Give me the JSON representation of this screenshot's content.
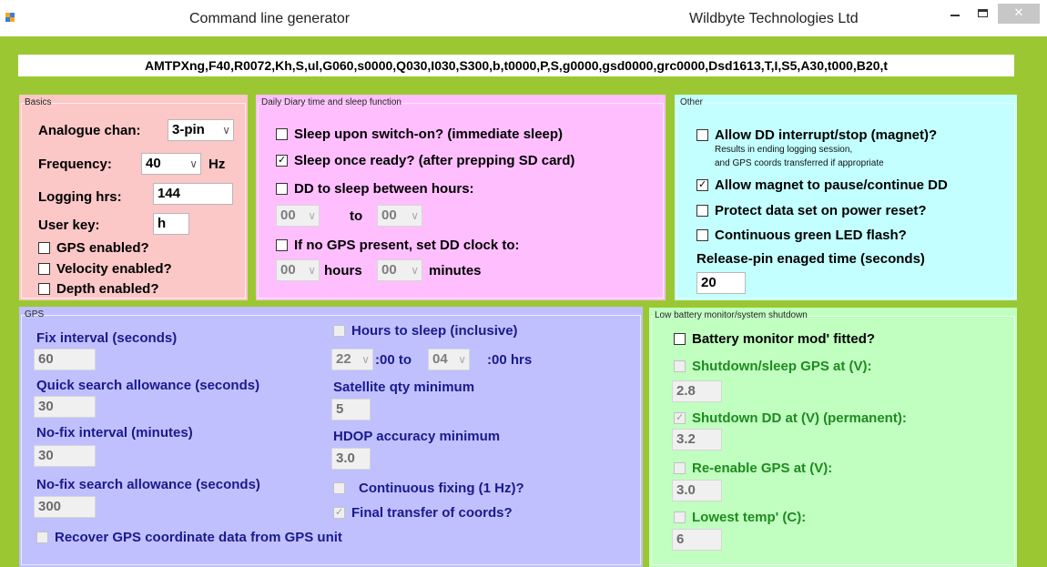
{
  "titlebar": {
    "title": "Command line generator",
    "company": "Wildbyte Technologies Ltd",
    "minimize_icon": "minimize-icon",
    "maximize_icon": "maximize-icon",
    "close_icon": "close-icon",
    "close_label": "✕"
  },
  "command_line": "AMTPXng,F40,R0072,Kh,S,ul,G060,s0000,Q030,I030,S300,b,t0000,P,S,g0000,gsd0000,grc0000,Dsd1613,T,I,S5,A30,t000,B20,t",
  "basics": {
    "legend": "Basics",
    "analogue_label": "Analogue chan:",
    "analogue_value": "3-pin",
    "frequency_label": "Frequency:",
    "frequency_value": "40",
    "frequency_unit": "Hz",
    "logging_label": "Logging hrs:",
    "logging_value": "144",
    "userkey_label": "User key:",
    "userkey_value": "h",
    "gps_enabled": "GPS enabled?",
    "velocity_enabled": "Velocity enabled?",
    "depth_enabled": "Depth enabled?"
  },
  "diary": {
    "legend": "Daily Diary time and sleep function",
    "sleep_switch_on": "Sleep upon switch-on? (immediate sleep)",
    "sleep_once_ready": "Sleep once ready? (after prepping SD card)",
    "sleep_between": "DD to sleep between hours:",
    "from_hour": "00",
    "to_label": "to",
    "to_hour": "00",
    "no_gps_clock": "If no GPS present, set DD clock to:",
    "clock_hours": "00",
    "hours_label": "hours",
    "clock_minutes": "00",
    "minutes_label": "minutes"
  },
  "other": {
    "legend": "Other",
    "allow_interrupt": "Allow DD interrupt/stop (magnet)?",
    "interrupt_note_1": "Results in ending logging session,",
    "interrupt_note_2": "and GPS coords transferred if appropriate",
    "allow_magnet_pause": "Allow magnet to pause/continue DD",
    "protect_data": "Protect data set on power reset?",
    "green_led": "Continuous green LED flash?",
    "release_label": "Release-pin enaged time (seconds)",
    "release_value": "20"
  },
  "gps": {
    "legend": "GPS",
    "fix_interval_label": "Fix interval (seconds)",
    "fix_interval_value": "60",
    "quick_search_label": "Quick search allowance (seconds)",
    "quick_search_value": "30",
    "nofix_interval_label": "No-fix interval (minutes)",
    "nofix_interval_value": "30",
    "nofix_search_label": "No-fix search allowance (seconds)",
    "nofix_search_value": "300",
    "recover_label": "Recover GPS coordinate data from GPS unit",
    "hours_sleep_label": "Hours to sleep (inclusive)",
    "sleep_from": "22",
    "sleep_from_suffix": ":00 to",
    "sleep_to": "04",
    "sleep_to_suffix": ":00 hrs",
    "sat_qty_label": "Satellite qty minimum",
    "sat_qty_value": "5",
    "hdop_label": "HDOP accuracy minimum",
    "hdop_value": "3.0",
    "continuous_fixing": "Continuous fixing (1 Hz)?",
    "final_transfer": "Final transfer of coords?"
  },
  "battery": {
    "legend": "Low battery monitor/system shutdown",
    "monitor_fitted": "Battery monitor mod' fitted?",
    "shutdown_gps_label": "Shutdown/sleep GPS at (V):",
    "shutdown_gps_value": "2.8",
    "shutdown_dd_label": "Shutdown DD at (V) (permanent):",
    "shutdown_dd_value": "3.2",
    "reenable_label": "Re-enable GPS at (V):",
    "reenable_value": "3.0",
    "lowest_temp_label": "Lowest temp' (C):",
    "lowest_temp_value": "6"
  },
  "colors": {
    "background": "#9bc832",
    "basics_panel": "#fbc7c7",
    "diary_panel": "#ffbfff",
    "other_panel": "#c3ffff",
    "gps_panel": "#c0c0ff",
    "battery_panel": "#c0ffc0"
  }
}
